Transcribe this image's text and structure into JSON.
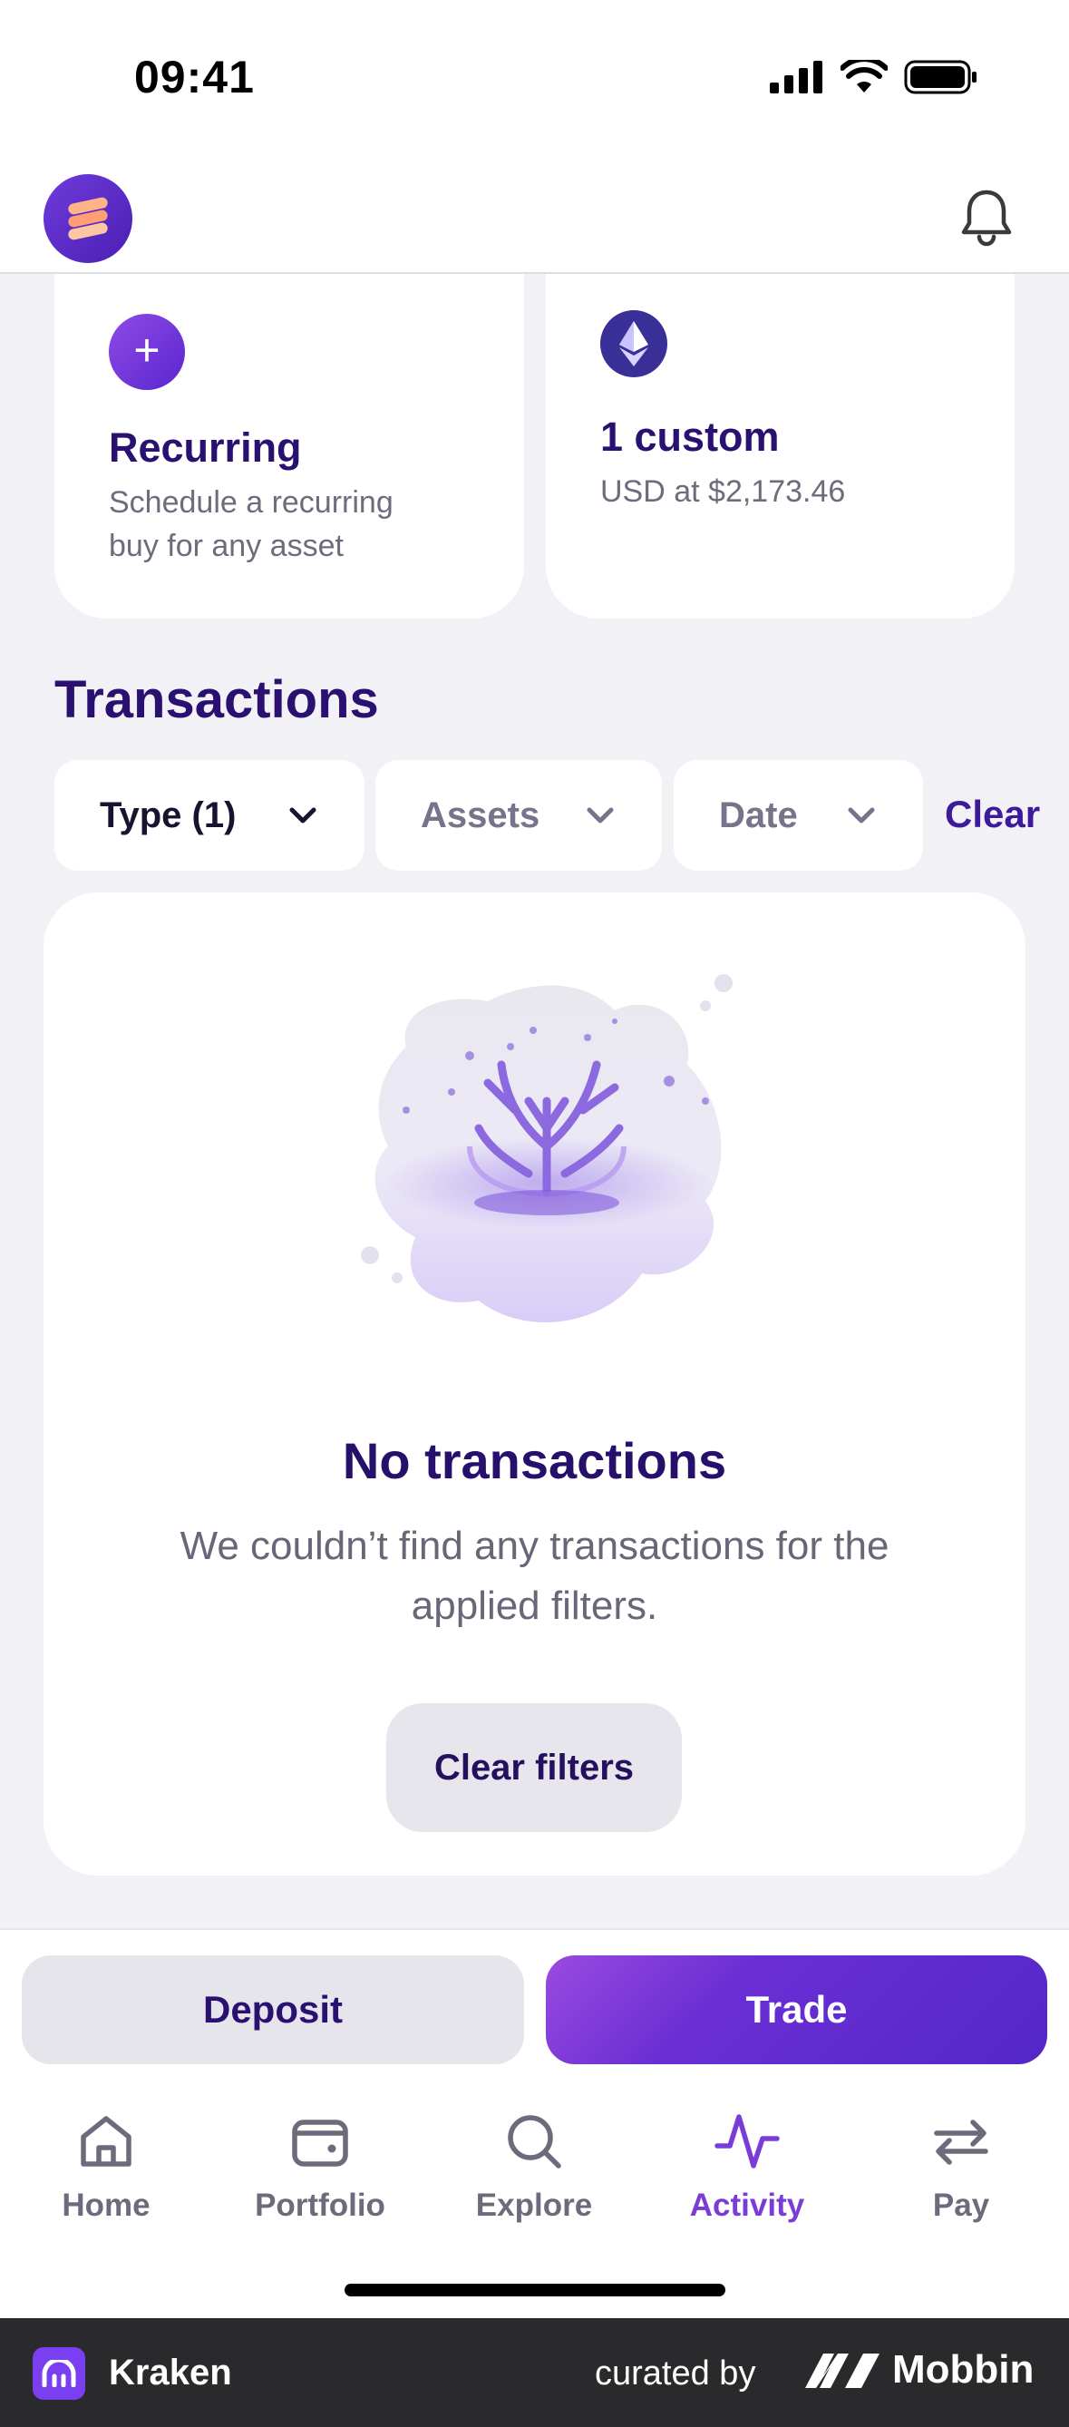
{
  "status_bar": {
    "time": "09:41"
  },
  "cards": {
    "recurring": {
      "title": "Recurring",
      "subtitle_line1": "Schedule a recurring",
      "subtitle_line2": "buy for any asset"
    },
    "custom": {
      "title": "1 custom",
      "subtitle": "USD at $2,173.46"
    }
  },
  "transactions": {
    "title": "Transactions",
    "filters": [
      {
        "label": "Type (1)",
        "active": true
      },
      {
        "label": "Assets",
        "active": false
      },
      {
        "label": "Date",
        "active": false
      }
    ],
    "clear_label": "Clear"
  },
  "empty_state": {
    "title": "No transactions",
    "message": "We couldn’t find any transactions for the applied filters.",
    "button": "Clear filters"
  },
  "actions": {
    "deposit": "Deposit",
    "trade": "Trade"
  },
  "tabbar": [
    {
      "label": "Home",
      "icon": "home-icon",
      "active": false
    },
    {
      "label": "Portfolio",
      "icon": "wallet-icon",
      "active": false
    },
    {
      "label": "Explore",
      "icon": "search-icon",
      "active": false
    },
    {
      "label": "Activity",
      "icon": "activity-icon",
      "active": true
    },
    {
      "label": "Pay",
      "icon": "transfer-icon",
      "active": false
    }
  ],
  "footer": {
    "app_name": "Kraken",
    "curated_by": "curated by",
    "brand": "Mobbin"
  },
  "colors": {
    "accent": "#7a3cd8",
    "title": "#2a1070",
    "background": "#f2f1f6"
  }
}
